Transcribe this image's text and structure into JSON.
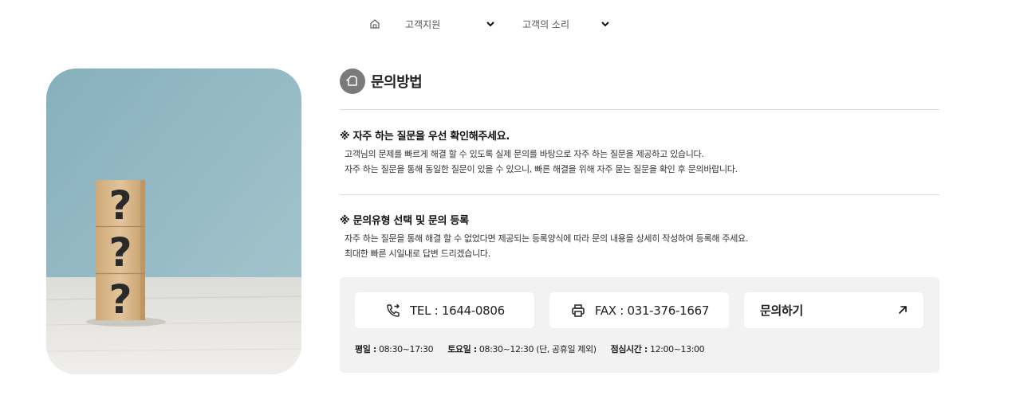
{
  "breadcrumb": {
    "home_icon": "home-icon",
    "items": [
      {
        "label": "고객지원",
        "icon": "chevron-down-icon"
      },
      {
        "label": "고객의 소리",
        "icon": "chevron-down-icon"
      }
    ]
  },
  "page": {
    "title": "문의방법",
    "title_icon": "edit-note-icon"
  },
  "sections": [
    {
      "heading": "※ 자주 하는 질문을 우선 확인해주세요.",
      "lines": [
        "고객님의 문제를 빠르게 해결 할 수 있도록 실제 문의를 바탕으로 자주 하는 질문을 제공하고 있습니다.",
        "자주 하는 질문을 통해 동일한 질문이 있을 수 있으니, 빠른 해결을 위해 자주 묻는 질문을 확인 후 문의바랍니다."
      ]
    },
    {
      "heading": "※ 문의유형 선택 및 문의 등록",
      "lines": [
        "자주 하는 질문을 통해 해결 할 수 없었다면 제공되는 등록양식에 따라 문의 내용을 상세히 작성하여 등록해 주세요.",
        "최대한 빠른 시일내로 답변 드리겠습니다."
      ]
    }
  ],
  "contact": {
    "tel": {
      "label": "TEL : 1644-0806",
      "icon": "phone-forward-icon"
    },
    "fax": {
      "label": "FAX : 031-376-1667",
      "icon": "printer-icon"
    },
    "inquiry": {
      "label": "문의하기",
      "icon": "arrow-up-right-icon"
    },
    "hours": [
      {
        "label": "평일 :",
        "value": " 08:30~17:30"
      },
      {
        "label": "토요일 :",
        "value": " 08:30~12:30 (단, 공휴일 제외)"
      },
      {
        "label": "점심시간 :",
        "value": " 12:00~13:00"
      }
    ]
  },
  "image": {
    "subject": "wooden-question-mark-blocks",
    "colors": {
      "sky": "#8fb7c3",
      "table": "#e8e6e2",
      "block": "#d9b88f"
    }
  }
}
